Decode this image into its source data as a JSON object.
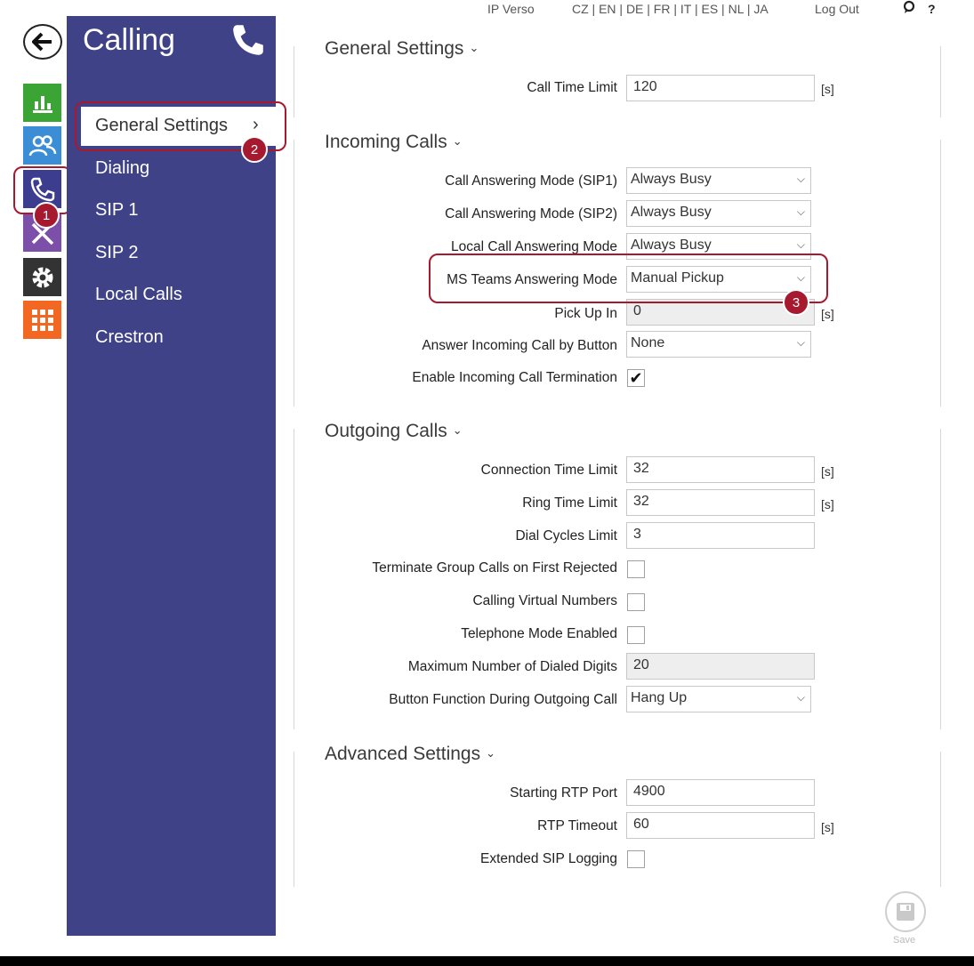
{
  "topbar": {
    "product": "IP Verso",
    "languages": "CZ | EN | DE | FR | IT | ES | NL | JA",
    "logout": "Log Out",
    "help": "?"
  },
  "sidebar": {
    "title": "Calling",
    "items": [
      {
        "label": "General Settings",
        "active": true
      },
      {
        "label": "Dialing"
      },
      {
        "label": "SIP 1"
      },
      {
        "label": "SIP 2"
      },
      {
        "label": "Local Calls"
      },
      {
        "label": "Crestron"
      }
    ],
    "active_chevron": "›"
  },
  "annotations": {
    "badge1": "1",
    "badge2": "2",
    "badge3": "3"
  },
  "sections": {
    "general": {
      "title": "General Settings",
      "call_time_limit": {
        "label": "Call Time Limit",
        "value": "120",
        "unit": "[s]"
      }
    },
    "incoming": {
      "title": "Incoming Calls",
      "mode_sip1": {
        "label": "Call Answering Mode (SIP1)",
        "value": "Always Busy"
      },
      "mode_sip2": {
        "label": "Call Answering Mode (SIP2)",
        "value": "Always Busy"
      },
      "mode_local": {
        "label": "Local Call Answering Mode",
        "value": "Always Busy"
      },
      "mode_teams": {
        "label": "MS Teams Answering Mode",
        "value": "Manual Pickup"
      },
      "pickup_in": {
        "label": "Pick Up In",
        "value": "0",
        "unit": "[s]"
      },
      "answer_button": {
        "label": "Answer Incoming Call by Button",
        "value": "None"
      },
      "termination": {
        "label": "Enable Incoming Call Termination",
        "checked": true
      }
    },
    "outgoing": {
      "title": "Outgoing Calls",
      "connection_limit": {
        "label": "Connection Time Limit",
        "value": "32",
        "unit": "[s]"
      },
      "ring_limit": {
        "label": "Ring Time Limit",
        "value": "32",
        "unit": "[s]"
      },
      "dial_cycles": {
        "label": "Dial Cycles Limit",
        "value": "3"
      },
      "terminate_group": {
        "label": "Terminate Group Calls on First Rejected",
        "checked": false
      },
      "virtual_numbers": {
        "label": "Calling Virtual Numbers",
        "checked": false
      },
      "telephone_mode": {
        "label": "Telephone Mode Enabled",
        "checked": false
      },
      "max_digits": {
        "label": "Maximum Number of Dialed Digits",
        "value": "20"
      },
      "button_function": {
        "label": "Button Function During Outgoing Call",
        "value": "Hang Up"
      }
    },
    "advanced": {
      "title": "Advanced Settings",
      "rtp_port": {
        "label": "Starting RTP Port",
        "value": "4900"
      },
      "rtp_timeout": {
        "label": "RTP Timeout",
        "value": "60",
        "unit": "[s]"
      },
      "sip_logging": {
        "label": "Extended SIP Logging",
        "checked": false
      }
    }
  },
  "save_label": "Save",
  "colors": {
    "sidebar": "#3f4287",
    "highlight": "#a6192e",
    "stats": "#3aa535",
    "users": "#3b8ed6",
    "calling": "#3d3d8f",
    "tools": "#7c4fa8",
    "settings": "#333333",
    "apps": "#f26722"
  }
}
